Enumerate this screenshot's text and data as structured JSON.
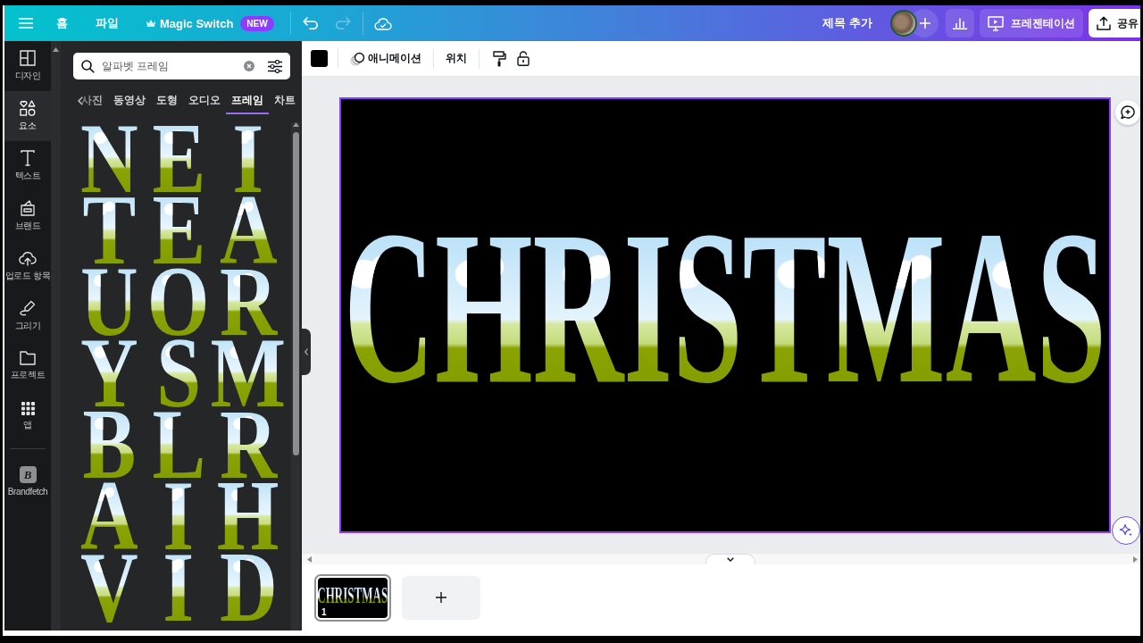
{
  "top_bar": {
    "menu": [
      {
        "label": "홈"
      },
      {
        "label": "파일"
      }
    ],
    "magic_switch": {
      "label": "Magic Switch",
      "badge": "NEW"
    },
    "undo": {
      "disabled": false
    },
    "redo": {
      "disabled": true
    },
    "title": "제목 추가",
    "present_button": "프레젠테이션",
    "share_button": "공유"
  },
  "rail": {
    "items": [
      {
        "kind": "design",
        "label": "디자인",
        "selected": false
      },
      {
        "kind": "elements",
        "label": "요소",
        "selected": true
      },
      {
        "kind": "text",
        "label": "텍스트",
        "selected": false
      },
      {
        "kind": "brand",
        "label": "브랜드",
        "selected": false
      },
      {
        "kind": "uploads",
        "label": "업로드 항목",
        "selected": false
      },
      {
        "kind": "draw",
        "label": "그리기",
        "selected": false
      },
      {
        "kind": "projects",
        "label": "프로젝트",
        "selected": false
      },
      {
        "kind": "apps",
        "label": "앱",
        "selected": false
      },
      {
        "kind": "app",
        "label": "Brandfetch",
        "glyph": "B",
        "selected": false
      }
    ]
  },
  "panel": {
    "search": {
      "value": "알파벳 프레임"
    },
    "tabs": [
      {
        "label": "사진",
        "selected": false
      },
      {
        "label": "동영상",
        "selected": false
      },
      {
        "label": "도형",
        "selected": false
      },
      {
        "label": "오디오",
        "selected": false
      },
      {
        "label": "프레임",
        "selected": true
      },
      {
        "label": "차트",
        "selected": false
      }
    ],
    "frames": [
      "N",
      "E",
      "I",
      "T",
      "E",
      "A",
      "U",
      "O",
      "R",
      "Y",
      "S",
      "M",
      "B",
      "L",
      "R",
      "A",
      "I",
      "H",
      "V",
      "I",
      "D"
    ]
  },
  "toolbar": {
    "animate_button": "애니메이션",
    "position_button": "위치"
  },
  "canvas": {
    "text": "CHRISTMAS",
    "selected": true
  },
  "pages": [
    {
      "number": "1",
      "text": "CHRISTMAS",
      "selected": true
    }
  ]
}
